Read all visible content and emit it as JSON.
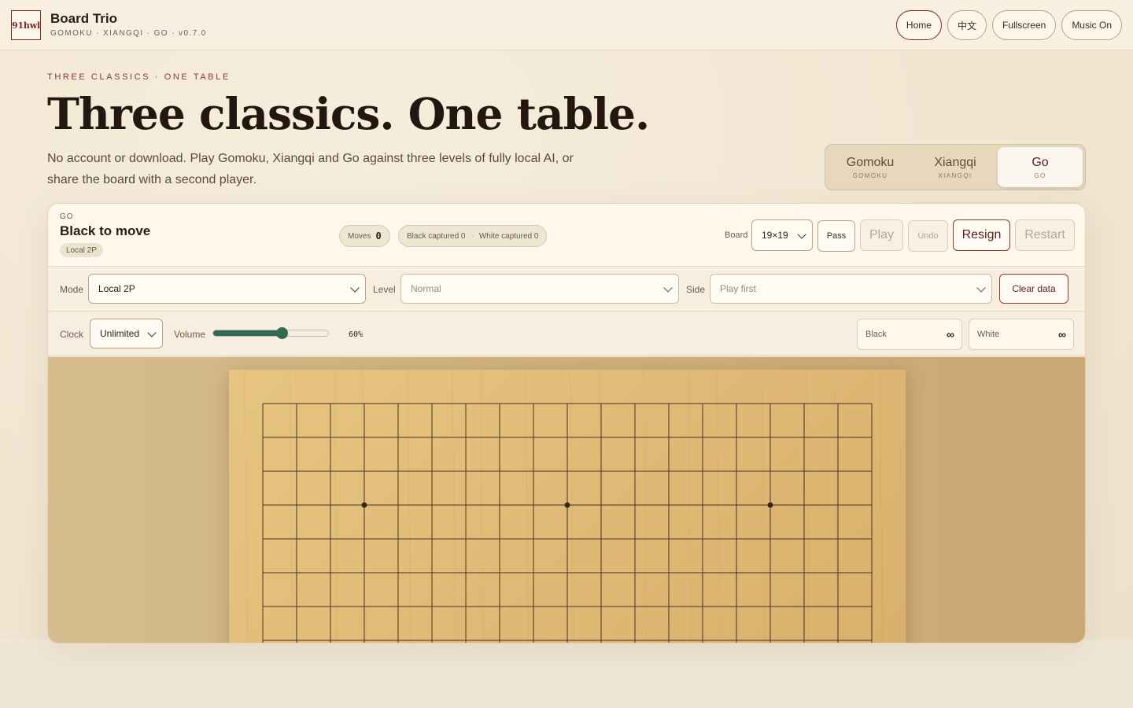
{
  "header": {
    "logo_text": "91hwl",
    "title": "Board Trio",
    "subtitle": "GOMOKU · XIANGQI · GO · v0.7.0",
    "nav": [
      {
        "label": "Home"
      },
      {
        "label": "中文"
      },
      {
        "label": "Fullscreen"
      },
      {
        "label": "Music On"
      }
    ]
  },
  "hero": {
    "eyebrow": "THREE CLASSICS · ONE TABLE",
    "title": "Three classics. One table.",
    "description": "No account or download. Play Gomoku, Xiangqi and Go against three levels of fully local AI, or share the board with a second player."
  },
  "game_switch": [
    {
      "label": "Gomoku",
      "sub": "GOMOKU",
      "active": false
    },
    {
      "label": "Xiangqi",
      "sub": "XIANGQI",
      "active": false
    },
    {
      "label": "Go",
      "sub": "GO",
      "active": true
    }
  ],
  "status": {
    "game": "GO",
    "turn": "Black to move",
    "mode_chip": "Local 2P",
    "moves_label": "Moves",
    "moves_value": "0",
    "black_captured": "Black captured 0",
    "white_captured": "White captured 0"
  },
  "toolbar": {
    "board_label": "Board",
    "board_size": "19×19",
    "pass": "Pass",
    "play": "Play",
    "undo": "Undo",
    "resign": "Resign",
    "restart": "Restart"
  },
  "settings": {
    "mode_label": "Mode",
    "mode_value": "Local 2P",
    "level_label": "Level",
    "level_value": "Normal",
    "side_label": "Side",
    "side_value": "Play first",
    "clear_data": "Clear data",
    "clock_label": "Clock",
    "clock_value": "Unlimited",
    "volume_label": "Volume",
    "volume_value": 0.6,
    "volume_text": "60%",
    "black_clock_label": "Black",
    "black_clock_value": "∞",
    "white_clock_label": "White",
    "white_clock_value": "∞"
  },
  "colors": {
    "accent": "#7a2a24",
    "slider": "#2f6a52",
    "board": "#e0bb77",
    "grid": "#4a3320"
  },
  "go_board": {
    "size": 19,
    "star_points": [
      [
        3,
        3
      ],
      [
        3,
        9
      ],
      [
        3,
        15
      ]
    ]
  }
}
